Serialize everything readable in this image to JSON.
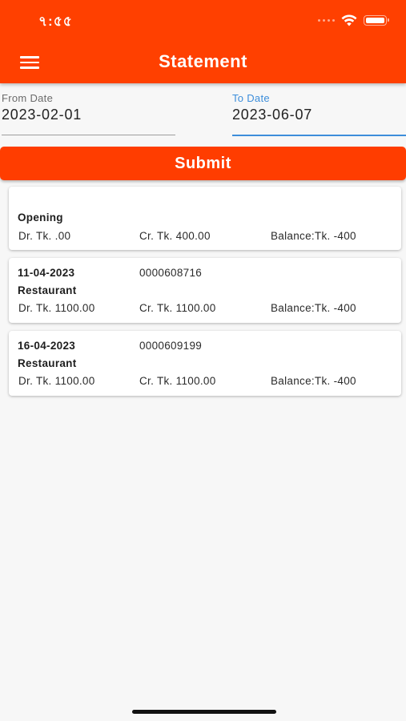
{
  "status_bar": {
    "time": "৭:৫৫"
  },
  "header": {
    "title": "Statement"
  },
  "filters": {
    "from_label": "From Date",
    "from_value": "2023-02-01",
    "to_label": "To Date",
    "to_value": "2023-06-07"
  },
  "submit_label": "Submit",
  "entries": [
    {
      "date": "",
      "ref": "",
      "description": "Opening",
      "debit": "Dr. Tk. .00",
      "credit": "Cr. Tk. 400.00",
      "balance": "Balance:Tk. -400"
    },
    {
      "date": "11-04-2023",
      "ref": "0000608716",
      "description": "Restaurant",
      "debit": "Dr. Tk. 1100.00",
      "credit": "Cr. Tk. 1100.00",
      "balance": "Balance:Tk. -400"
    },
    {
      "date": "16-04-2023",
      "ref": "0000609199",
      "description": "Restaurant",
      "debit": "Dr. Tk. 1100.00",
      "credit": "Cr. Tk. 1100.00",
      "balance": "Balance:Tk. -400"
    }
  ],
  "colors": {
    "primary": "#ff4000",
    "accent_underline": "#3d8edb",
    "background": "#f7f7f7"
  },
  "icons": [
    "menu-icon",
    "wifi-icon",
    "battery-icon",
    "signal-icon"
  ]
}
